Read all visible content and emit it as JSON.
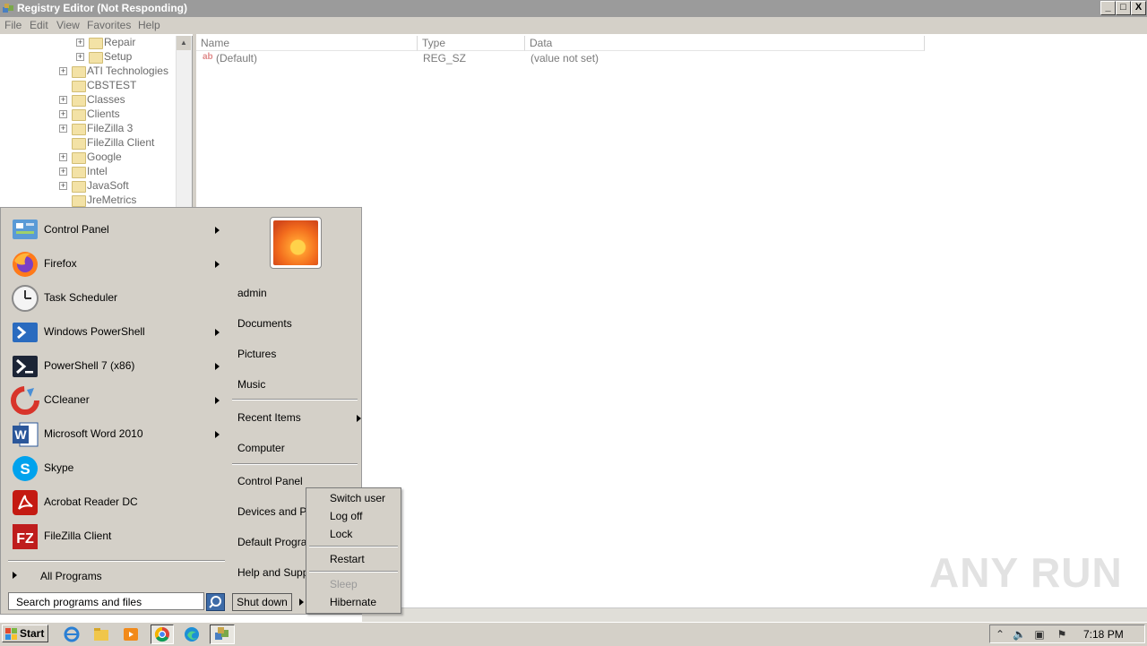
{
  "window": {
    "title": "Registry Editor (Not Responding)",
    "min_glyph": "_",
    "max_glyph": "□",
    "close_glyph": "X"
  },
  "menubar": [
    "File",
    "Edit",
    "View",
    "Favorites",
    "Help"
  ],
  "tree": {
    "items": [
      {
        "label": "Repair",
        "expandable": true
      },
      {
        "label": "Setup",
        "expandable": true
      },
      {
        "label": "ATI Technologies",
        "expandable": true
      },
      {
        "label": "CBSTEST",
        "expandable": false
      },
      {
        "label": "Classes",
        "expandable": true
      },
      {
        "label": "Clients",
        "expandable": true
      },
      {
        "label": "FileZilla 3",
        "expandable": true
      },
      {
        "label": "FileZilla Client",
        "expandable": false
      },
      {
        "label": "Google",
        "expandable": true
      },
      {
        "label": "Intel",
        "expandable": true
      },
      {
        "label": "JavaSoft",
        "expandable": true
      },
      {
        "label": "JreMetrics",
        "expandable": false
      }
    ]
  },
  "list": {
    "columns": [
      "Name",
      "Type",
      "Data"
    ],
    "rows": [
      {
        "name": "(Default)",
        "type": "REG_SZ",
        "data": "(value not set)",
        "icon": "string-value-icon"
      }
    ]
  },
  "start_menu": {
    "programs": [
      {
        "label": "Control Panel",
        "icon": "control-panel-icon",
        "submenu": true
      },
      {
        "label": "Firefox",
        "icon": "firefox-icon",
        "submenu": true
      },
      {
        "label": "Task Scheduler",
        "icon": "task-scheduler-icon",
        "submenu": false
      },
      {
        "label": "Windows PowerShell",
        "icon": "powershell-icon",
        "submenu": true
      },
      {
        "label": "PowerShell 7 (x86)",
        "icon": "powershell7-icon",
        "submenu": true
      },
      {
        "label": "CCleaner",
        "icon": "ccleaner-icon",
        "submenu": true
      },
      {
        "label": "Microsoft Word 2010",
        "icon": "word-icon",
        "submenu": true
      },
      {
        "label": "Skype",
        "icon": "skype-icon",
        "submenu": false
      },
      {
        "label": "Acrobat Reader DC",
        "icon": "acrobat-icon",
        "submenu": false
      },
      {
        "label": "FileZilla Client",
        "icon": "filezilla-icon",
        "submenu": false
      }
    ],
    "all_programs": "All Programs",
    "search_placeholder": "Search programs and files",
    "places": [
      {
        "label": "admin",
        "submenu": false
      },
      {
        "label": "Documents",
        "submenu": false
      },
      {
        "label": "Pictures",
        "submenu": false
      },
      {
        "label": "Music",
        "submenu": false
      },
      {
        "label": "Recent Items",
        "submenu": true
      },
      {
        "label": "Computer",
        "submenu": false
      },
      {
        "label": "Control Panel",
        "submenu": false
      },
      {
        "label": "Devices and Pri",
        "submenu": false
      },
      {
        "label": "Default Program",
        "submenu": false
      },
      {
        "label": "Help and Suppo",
        "submenu": false
      }
    ],
    "shutdown_label": "Shut down"
  },
  "shutdown_menu": {
    "items": [
      {
        "label": "Switch user",
        "enabled": true
      },
      {
        "label": "Log off",
        "enabled": true
      },
      {
        "label": "Lock",
        "enabled": true
      },
      {
        "label": "Restart",
        "enabled": true
      },
      {
        "label": "Sleep",
        "enabled": false
      },
      {
        "label": "Hibernate",
        "enabled": true
      }
    ]
  },
  "taskbar": {
    "start_label": "Start",
    "pinned": [
      "ie-icon",
      "explorer-icon",
      "media-player-icon",
      "chrome-icon",
      "edge-icon",
      "regedit-icon"
    ],
    "clock": "7:18 PM"
  },
  "watermark": "ANY RUN",
  "colors": {
    "titlebar": "#9b9b9b",
    "face": "#d4d0c8",
    "search_button": "#3d6ba8"
  }
}
